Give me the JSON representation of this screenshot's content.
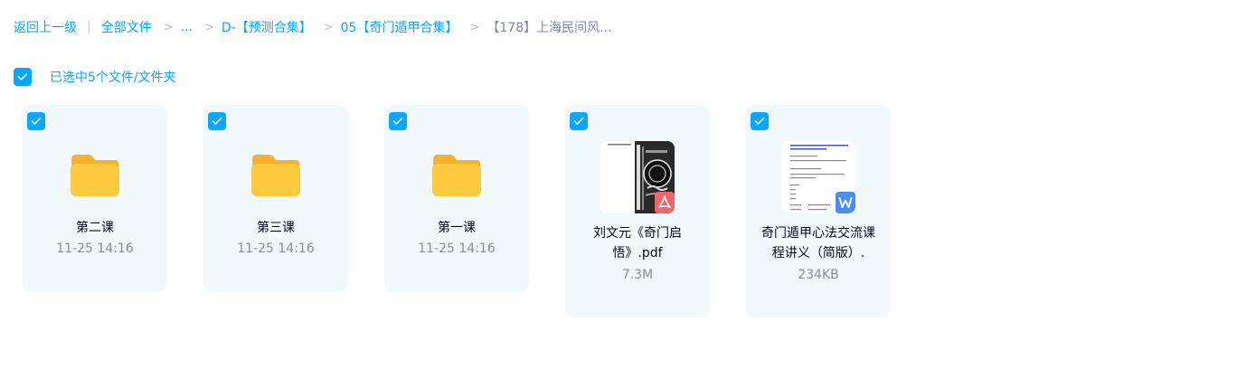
{
  "breadcrumb": {
    "back": "返回上一级",
    "divider": "|",
    "all_files": "全部文件",
    "sep": ">",
    "ellipsis": "...",
    "level1": "D-【预测合集】",
    "level2": "05【奇门遁甲合集】",
    "current": "【178】上海民间风..."
  },
  "selection": {
    "label": "已选中5个文件/文件夹"
  },
  "files": [
    {
      "name": "第二课",
      "meta": "11-25 14:16",
      "type": "folder"
    },
    {
      "name": "第三课",
      "meta": "11-25 14:16",
      "type": "folder"
    },
    {
      "name": "第一课",
      "meta": "11-25 14:16",
      "type": "folder"
    },
    {
      "name": "刘文元《奇门启悟》.pdf",
      "meta": "7.3M",
      "type": "pdf"
    },
    {
      "name": "奇门遁甲心法交流课程讲义（简版）.",
      "meta": "234KB",
      "type": "word"
    }
  ],
  "colors": {
    "accent": "#06a7ff",
    "tile_bg": "#f2f9fd",
    "folder": "#ffc940",
    "pdf_badge": "#f4646c",
    "word_badge": "#4b8cf5"
  }
}
